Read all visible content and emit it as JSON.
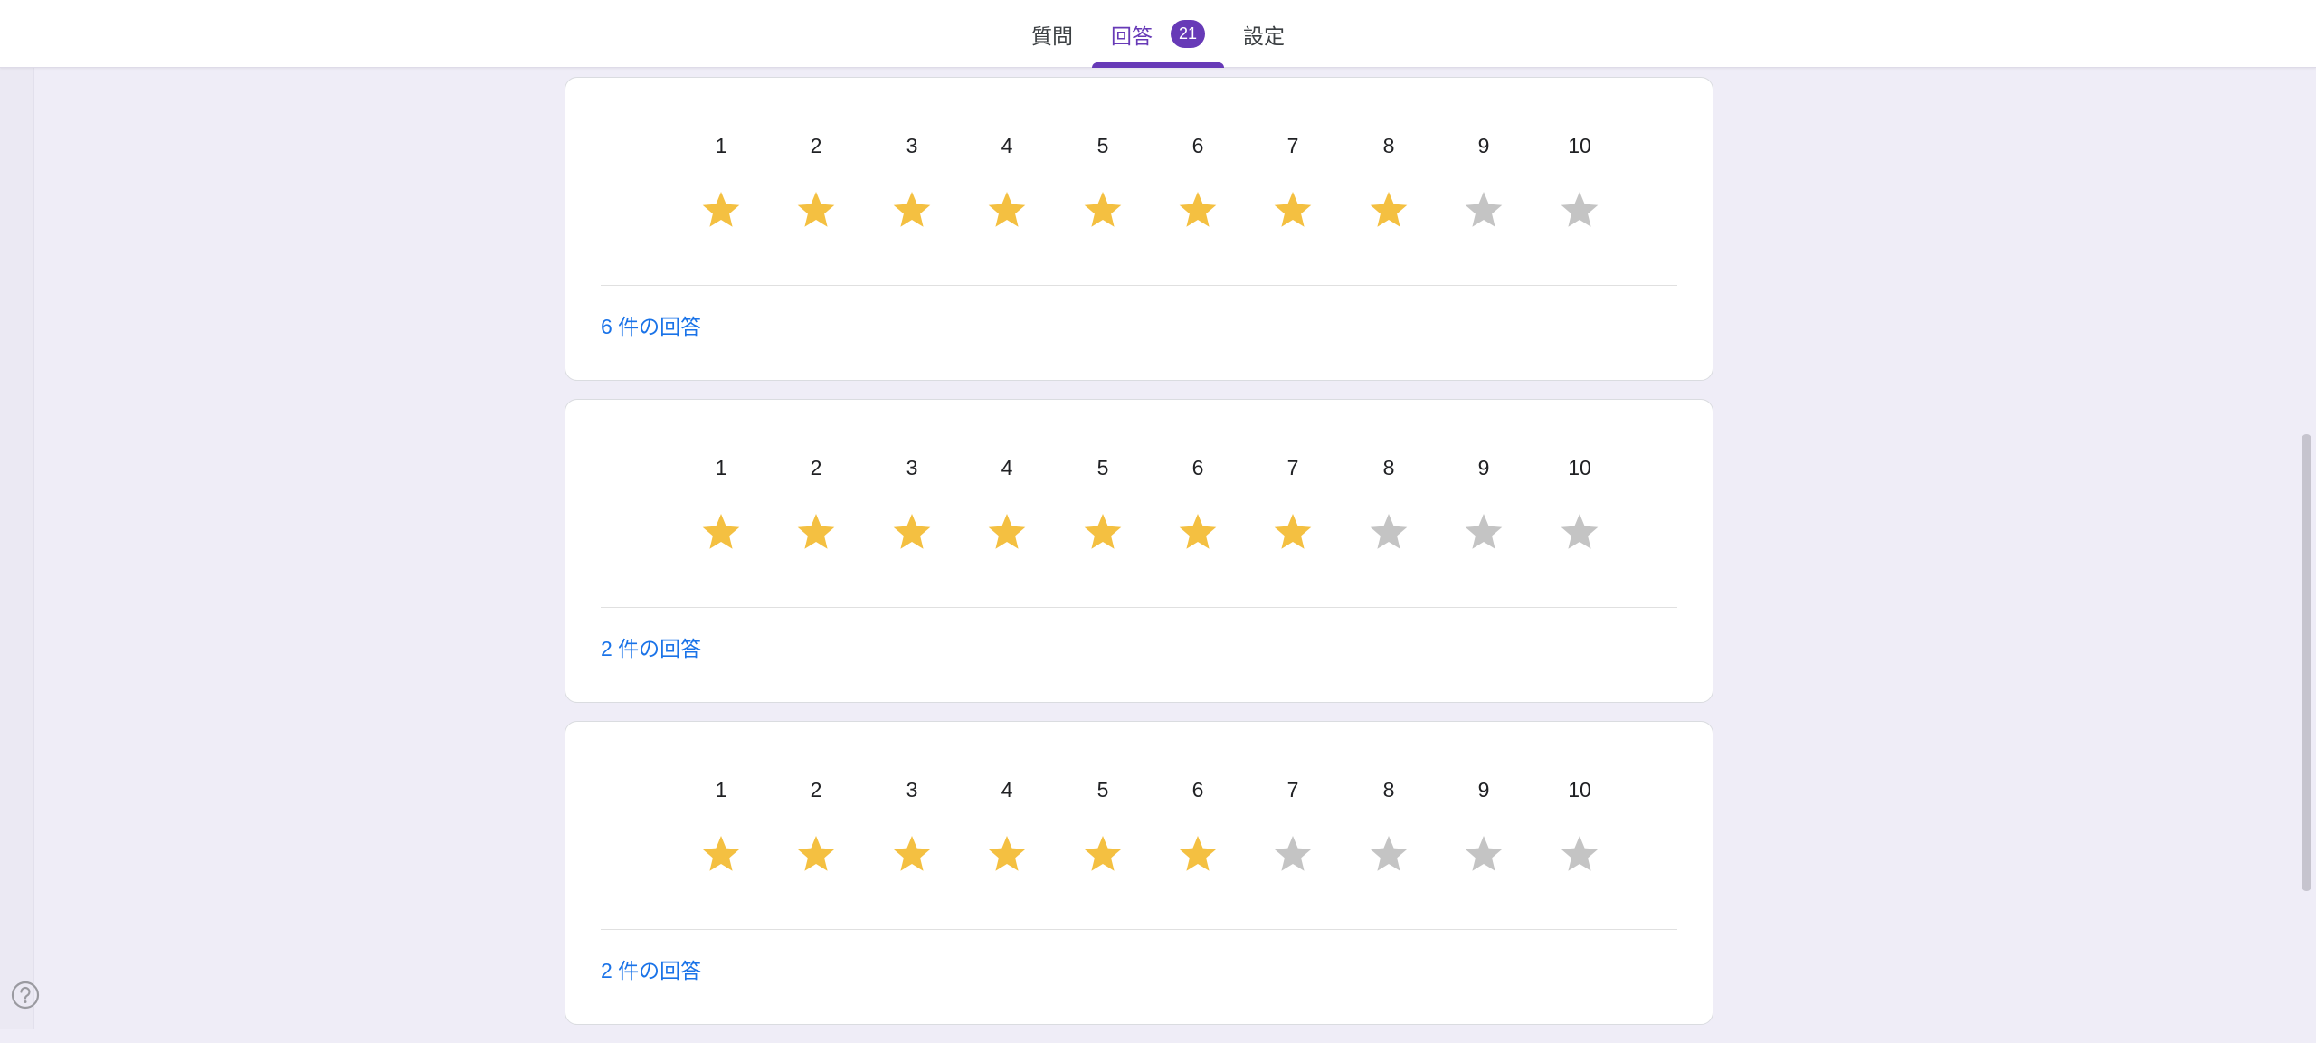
{
  "tabs": [
    {
      "label": "質問",
      "active": false
    },
    {
      "label": "回答",
      "active": true,
      "badge": "21"
    },
    {
      "label": "設定",
      "active": false
    }
  ],
  "colors": {
    "accent": "#673ab7",
    "star_filled": "#f4c041",
    "star_empty": "#c4c4c4",
    "link": "#1a73e8"
  },
  "scale_labels": [
    "1",
    "2",
    "3",
    "4",
    "5",
    "6",
    "7",
    "8",
    "9",
    "10"
  ],
  "cards": [
    {
      "rating": 8,
      "max": 10,
      "responses_label": "6 件の回答"
    },
    {
      "rating": 7,
      "max": 10,
      "responses_label": "2 件の回答"
    },
    {
      "rating": 6,
      "max": 10,
      "responses_label": "2 件の回答"
    }
  ],
  "help": {
    "icon": "help-circle-icon"
  }
}
